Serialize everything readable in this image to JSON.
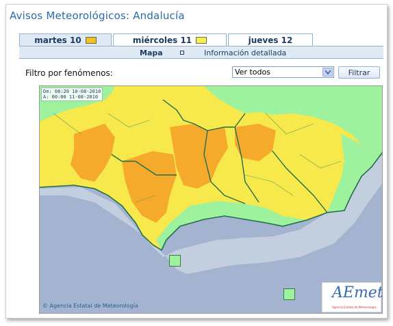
{
  "page": {
    "title": "Avisos Meteorológicos: Andalucía"
  },
  "tabs": [
    {
      "label": "martes 10",
      "swatch": "#f0c21a",
      "active": true
    },
    {
      "label": "miércoles 11",
      "swatch": "#f6f24a",
      "active": false
    },
    {
      "label": "jueves 12",
      "swatch": "",
      "active": false
    }
  ],
  "subnav": {
    "map_label": "Mapa",
    "detail_label": "Información detallada"
  },
  "filter": {
    "label": "Filtro por fenómenos:",
    "selected": "Ver todos",
    "button_label": "Filtrar"
  },
  "map": {
    "valid_from": "De: 08:20 10-08-2010",
    "valid_to": "A:  00:00 11-08-2010",
    "credit": "© Agencia Estatal de Meteorología",
    "logo_text": "AEmet",
    "logo_sub": "Agencia Estatal de Meteorología",
    "colors": {
      "sea": "#a4b4d0",
      "shelf": "#c3cede",
      "orange": "#f5aa2c",
      "yellow": "#f7e84c",
      "green": "#9ef29e",
      "border": "#1f6d4a"
    }
  }
}
